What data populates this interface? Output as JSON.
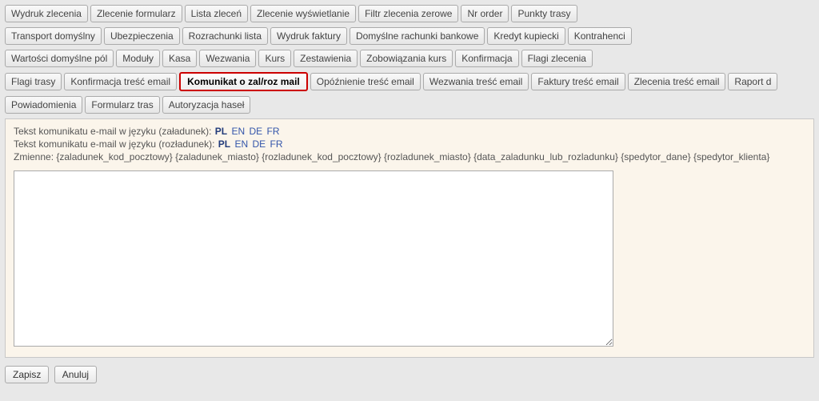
{
  "tabs": {
    "rows": [
      [
        "Wydruk zlecenia",
        "Zlecenie formularz",
        "Lista zleceń",
        "Zlecenie wyświetlanie",
        "Filtr zlecenia zerowe",
        "Nr order",
        "Punkty trasy"
      ],
      [
        "Transport domyślny",
        "Ubezpieczenia",
        "Rozrachunki lista",
        "Wydruk faktury",
        "Domyślne rachunki bankowe",
        "Kredyt kupiecki",
        "Kontrahenci"
      ],
      [
        "Wartości domyślne pól",
        "Moduły",
        "Kasa",
        "Wezwania",
        "Kurs",
        "Zestawienia",
        "Zobowiązania kurs",
        "Konfirmacja",
        "Flagi zlecenia"
      ],
      [
        "Flagi trasy",
        "Konfirmacja treść email",
        "Komunikat o zal/roz mail",
        "Opóźnienie treść email",
        "Wezwania treść email",
        "Faktury treść email",
        "Zlecenia treść email",
        "Raport d"
      ],
      [
        "Powiadomienia",
        "Formularz tras",
        "Autoryzacja haseł"
      ]
    ],
    "activeRow": 3,
    "activeIndex": 2
  },
  "content": {
    "loadingLabel": "Tekst komunikatu e-mail w języku (załadunek):",
    "unloadingLabel": "Tekst komunikatu e-mail w języku (rozładunek):",
    "langs": [
      "PL",
      "EN",
      "DE",
      "FR"
    ],
    "selectedLangLoading": "PL",
    "selectedLangUnloading": "PL",
    "variablesLabel": "Zmienne:",
    "variables": "{zaladunek_kod_pocztowy} {zaladunek_miasto} {rozladunek_kod_pocztowy} {rozladunek_miasto} {data_zaladunku_lub_rozladunku} {spedytor_dane} {spedytor_klienta}",
    "textareaValue": ""
  },
  "actions": {
    "save": "Zapisz",
    "cancel": "Anuluj"
  }
}
